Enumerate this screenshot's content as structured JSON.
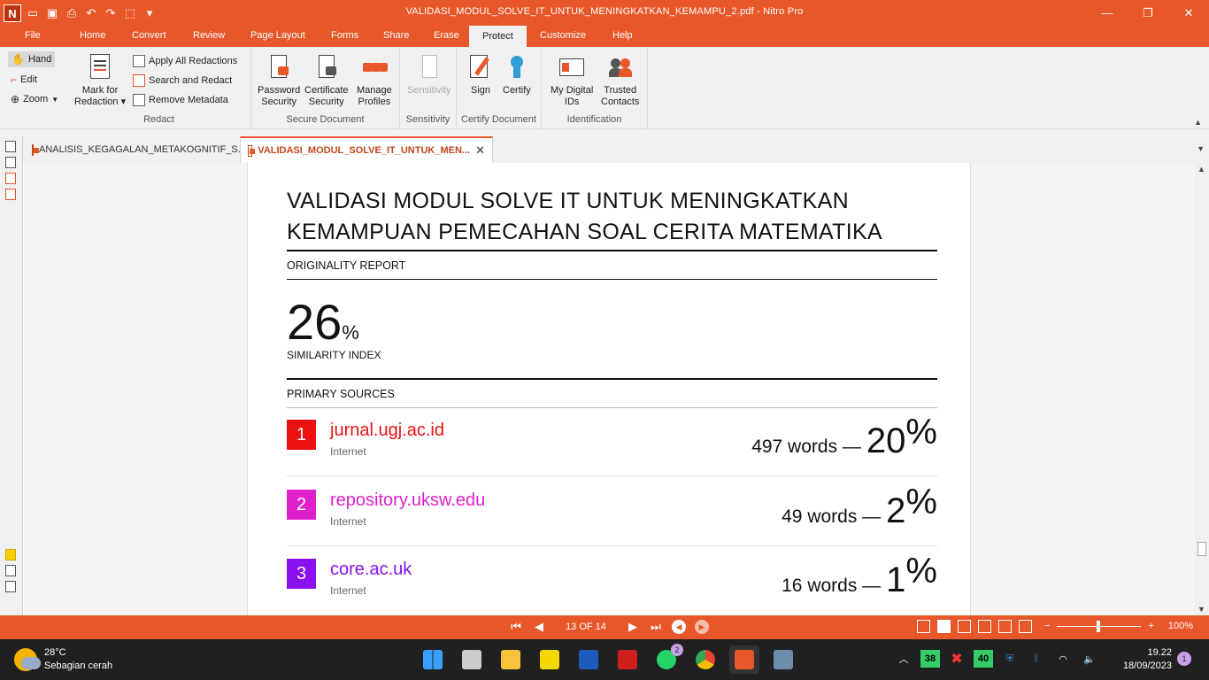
{
  "window": {
    "title": "VALIDASI_MODUL_SOLVE_IT_UNTUK_MENINGKATKAN_KEMAMPU_2.pdf - Nitro Pro",
    "logo": "N"
  },
  "menu": {
    "file": "File",
    "tabs": [
      "Home",
      "Convert",
      "Review",
      "Page Layout",
      "Forms",
      "Share",
      "Erase",
      "Protect",
      "Customize",
      "Help"
    ],
    "active": "Protect"
  },
  "ribbon": {
    "tools": {
      "hand": "Hand",
      "edit": "Edit",
      "zoom": "Zoom"
    },
    "redact": {
      "mark_line1": "Mark for",
      "mark_line2": "Redaction",
      "apply": "Apply All Redactions",
      "search": "Search and Redact",
      "remove": "Remove Metadata",
      "label": "Redact"
    },
    "secure": {
      "password_line1": "Password",
      "password_line2": "Security",
      "certificate_line1": "Certificate",
      "certificate_line2": "Security",
      "manage_line1": "Manage",
      "manage_line2": "Profiles",
      "label": "Secure Document"
    },
    "sensitivity": {
      "button": "Sensitivity",
      "label": "Sensitivity"
    },
    "certify": {
      "sign": "Sign",
      "certify": "Certify",
      "label": "Certify Document"
    },
    "identification": {
      "ids_line1": "My Digital",
      "ids_line2": "IDs",
      "contacts_line1": "Trusted",
      "contacts_line2": "Contacts",
      "label": "Identification"
    }
  },
  "tabs": {
    "inactive": "ANALISIS_KEGAGALAN_METAKOGNITIF_S...",
    "active": "VALIDASI_MODUL_SOLVE_IT_UNTUK_MEN..."
  },
  "document": {
    "title_line1": "VALIDASI MODUL SOLVE IT UNTUK MENINGKATKAN",
    "title_line2": "KEMAMPUAN PEMECAHAN SOAL CERITA MATEMATIKA",
    "originality": "ORIGINALITY REPORT",
    "similarity_value": "26",
    "similarity_pct": "%",
    "similarity_label": "SIMILARITY INDEX",
    "primary_sources": "PRIMARY SOURCES",
    "sources": [
      {
        "num": "1",
        "name": "jurnal.ugj.ac.id",
        "type": "Internet",
        "words": "497 words —",
        "pct": "20",
        "color": "#ee1111"
      },
      {
        "num": "2",
        "name": "repository.uksw.edu",
        "type": "Internet",
        "words": "49 words —",
        "pct": "2",
        "color": "#dd22cc"
      },
      {
        "num": "3",
        "name": "core.ac.uk",
        "type": "Internet",
        "words": "16 words —",
        "pct": "1",
        "color": "#8811ee"
      }
    ]
  },
  "status": {
    "page": "13 OF 14",
    "zoom": "100%"
  },
  "taskbar": {
    "temp": "28°C",
    "weather": "Sebagian cerah",
    "whatsapp_badge": "2",
    "tray_a": "38",
    "tray_b": "40",
    "time": "19.22",
    "date": "18/09/2023",
    "notif": "1"
  },
  "colors": {
    "accent": "#e8572a"
  }
}
